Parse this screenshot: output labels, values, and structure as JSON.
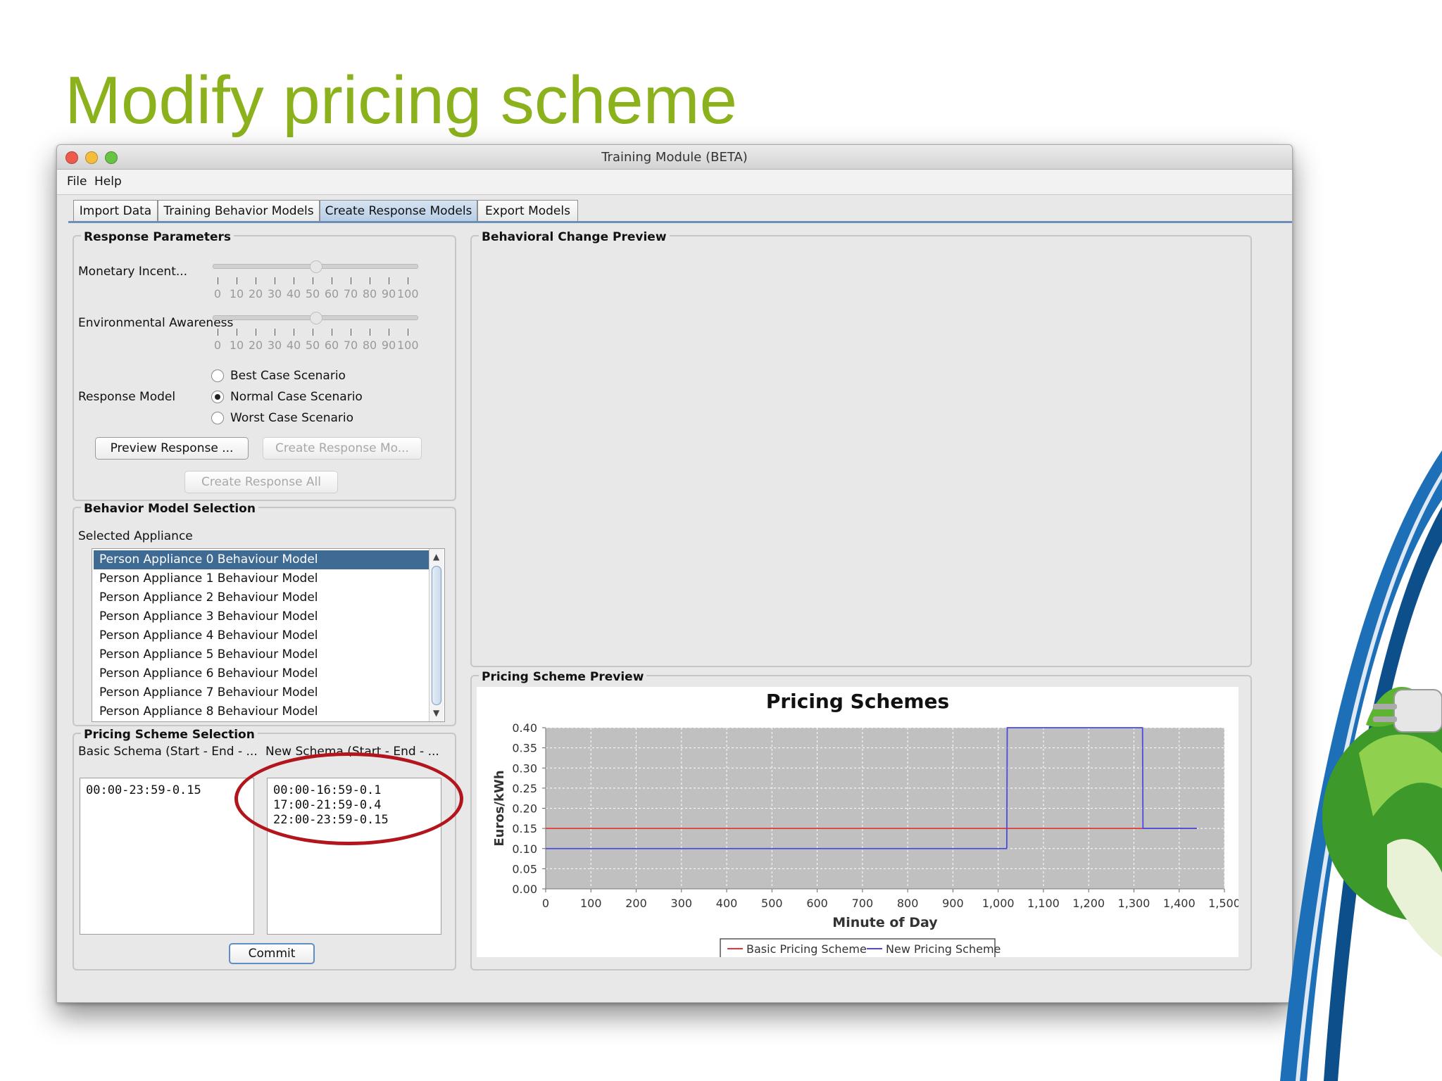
{
  "slide": {
    "title": "Modify pricing scheme"
  },
  "window": {
    "title": "Training Module (BETA)",
    "menu": [
      "File",
      "Help"
    ],
    "tabs": [
      {
        "label": "Import Data",
        "active": false
      },
      {
        "label": "Training Behavior Models",
        "active": false
      },
      {
        "label": "Create Response Models",
        "active": true
      },
      {
        "label": "Export Models",
        "active": false
      }
    ]
  },
  "response_parameters": {
    "title": "Response Parameters",
    "sliders": [
      {
        "label": "Monetary Incent...",
        "value": 50
      },
      {
        "label": "Environmental Awareness",
        "value": 50
      }
    ],
    "tick_labels": [
      "0",
      "10",
      "20",
      "30",
      "40",
      "50",
      "60",
      "70",
      "80",
      "90",
      "100"
    ],
    "response_model_label": "Response Model",
    "radios": [
      {
        "label": "Best Case Scenario",
        "checked": false
      },
      {
        "label": "Normal Case Scenario",
        "checked": true
      },
      {
        "label": "Worst Case Scenario",
        "checked": false
      }
    ],
    "preview_button": "Preview Response ...",
    "create_button": "Create Response Mo...",
    "create_all_button": "Create Response All"
  },
  "behavior_model_selection": {
    "title": "Behavior Model Selection",
    "selected_label": "Selected Appliance",
    "items": [
      "Person Appliance 0 Behaviour Model",
      "Person Appliance 1 Behaviour Model",
      "Person Appliance 2 Behaviour Model",
      "Person Appliance 3 Behaviour Model",
      "Person Appliance 4 Behaviour Model",
      "Person Appliance 5 Behaviour Model",
      "Person Appliance 6 Behaviour Model",
      "Person Appliance 7 Behaviour Model",
      "Person Appliance 8 Behaviour Model"
    ],
    "selected_index": 0
  },
  "pricing_scheme_selection": {
    "title": "Pricing Scheme Selection",
    "basic_header": "Basic Schema (Start - End - ...",
    "new_header": "New Schema (Start - End - ...",
    "basic_lines": [
      "00:00-23:59-0.15"
    ],
    "new_lines": [
      "00:00-16:59-0.1",
      "17:00-21:59-0.4",
      "22:00-23:59-0.15"
    ],
    "commit_button": "Commit"
  },
  "behavioral_change_preview": {
    "title": "Behavioral Change Preview"
  },
  "pricing_scheme_preview": {
    "title": "Pricing Scheme Preview"
  },
  "colors": {
    "slide_title": "#8bb21c",
    "annotation": "#b3151c",
    "basic_series": "#e23a3a",
    "new_series": "#4a4ae0",
    "plot_bg": "#c0c0c0"
  },
  "chart_data": {
    "type": "line",
    "title": "Pricing Schemes",
    "xlabel": "Minute of Day",
    "ylabel": "Euros/kWh",
    "xlim": [
      0,
      1500
    ],
    "ylim": [
      0,
      0.4
    ],
    "x_ticks": [
      0,
      100,
      200,
      300,
      400,
      500,
      600,
      700,
      800,
      900,
      1000,
      1100,
      1200,
      1300,
      1400,
      1500
    ],
    "x_tick_labels": [
      "0",
      "100",
      "200",
      "300",
      "400",
      "500",
      "600",
      "700",
      "800",
      "900",
      "1,000",
      "1,100",
      "1,200",
      "1,300",
      "1,400",
      "1,500"
    ],
    "y_ticks": [
      0,
      0.05,
      0.1,
      0.15,
      0.2,
      0.25,
      0.3,
      0.35,
      0.4
    ],
    "y_tick_labels": [
      "0.00",
      "0.05",
      "0.10",
      "0.15",
      "0.20",
      "0.25",
      "0.30",
      "0.35",
      "0.40"
    ],
    "grid": true,
    "legend": "bottom",
    "series": [
      {
        "name": "Basic Pricing Scheme",
        "color": "#e23a3a",
        "x": [
          0,
          1439
        ],
        "y": [
          0.15,
          0.15
        ]
      },
      {
        "name": "New Pricing Scheme",
        "color": "#4a4ae0",
        "x": [
          0,
          1019,
          1020,
          1319,
          1320,
          1439
        ],
        "y": [
          0.1,
          0.1,
          0.4,
          0.4,
          0.15,
          0.15
        ]
      }
    ]
  }
}
